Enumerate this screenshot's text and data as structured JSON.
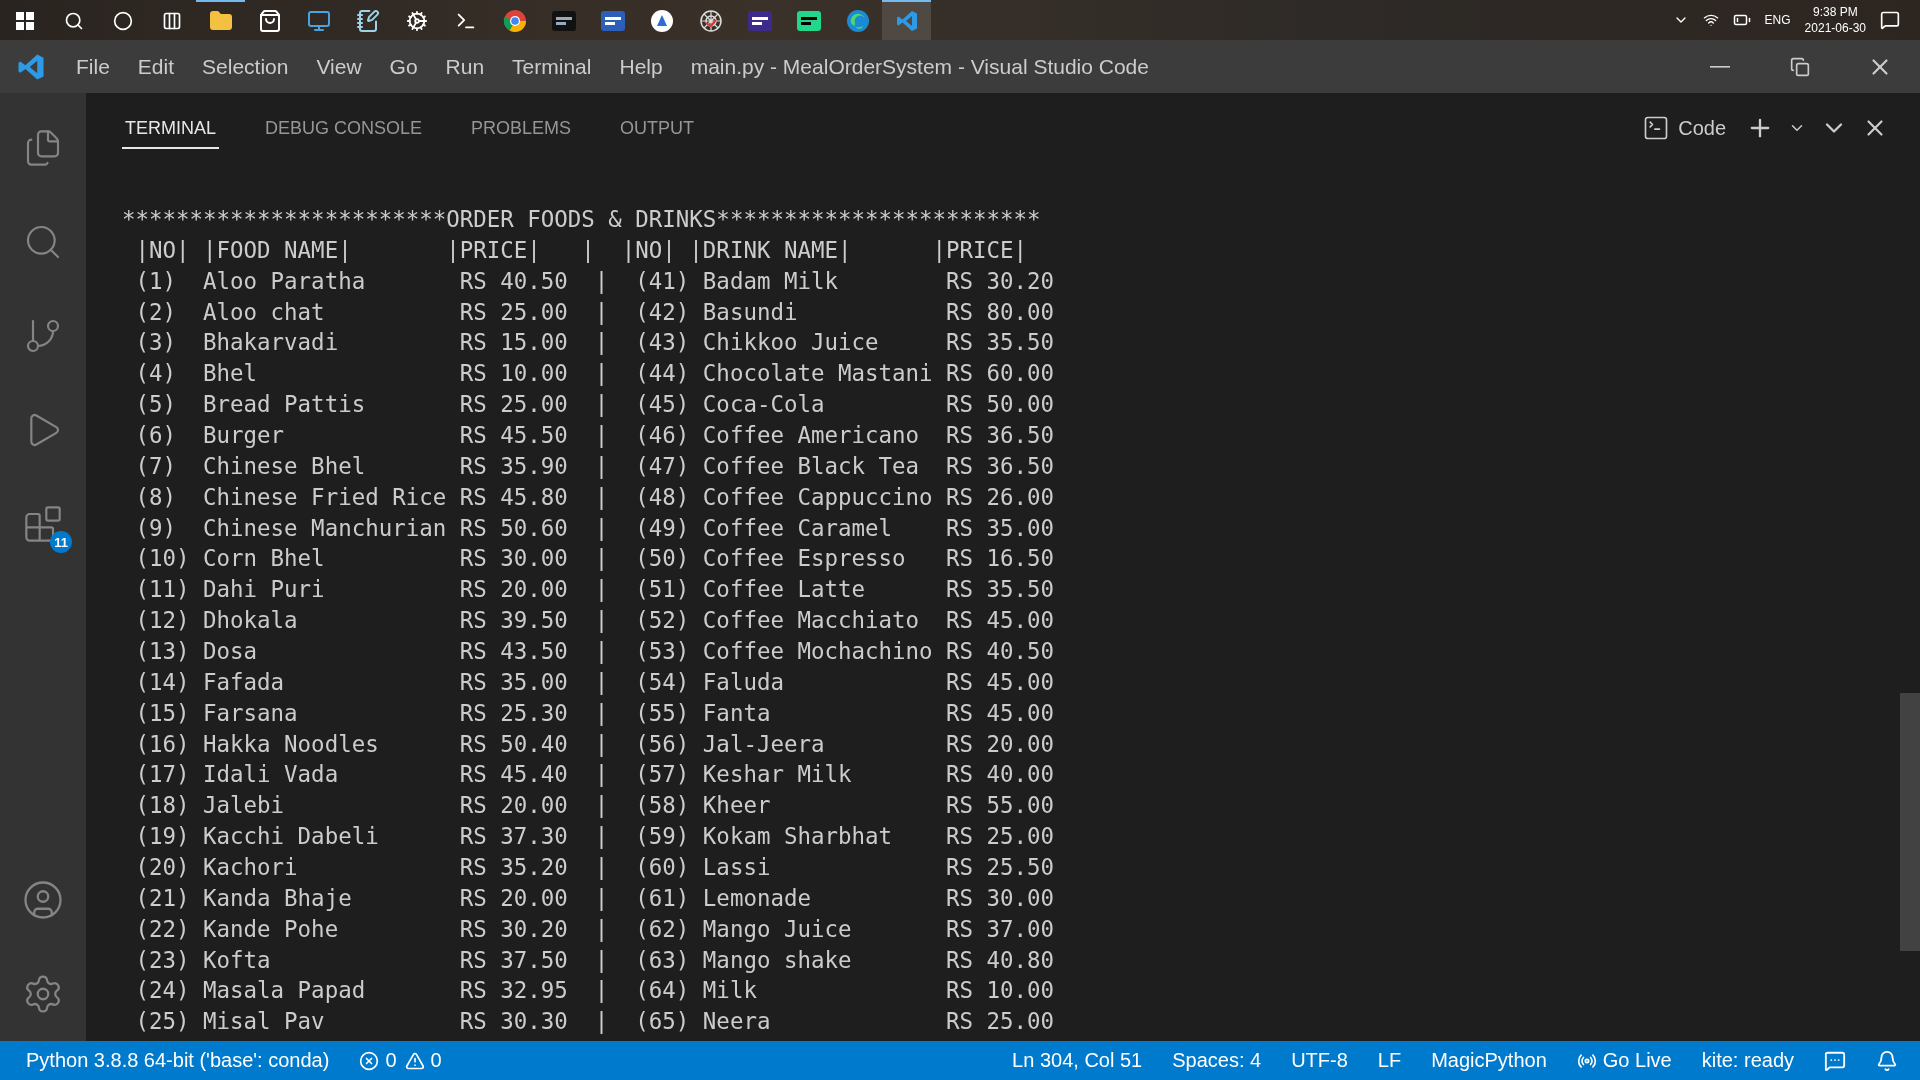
{
  "taskbar": {
    "tray": {
      "language": "ENG",
      "time": "9:38 PM",
      "date": "2021-06-30"
    }
  },
  "window": {
    "menu": [
      "File",
      "Edit",
      "Selection",
      "View",
      "Go",
      "Run",
      "Terminal",
      "Help"
    ],
    "title": "main.py - MealOrderSystem - Visual Studio Code"
  },
  "activity_bar": {
    "extensions_badge": "11"
  },
  "panel": {
    "tabs": [
      {
        "label": "TERMINAL",
        "selected": true
      },
      {
        "label": "DEBUG CONSOLE",
        "selected": false
      },
      {
        "label": "PROBLEMS",
        "selected": false
      },
      {
        "label": "OUTPUT",
        "selected": false
      }
    ],
    "terminal_name": "Code"
  },
  "terminal": {
    "banner": "************************ORDER FOODS & DRINKS************************",
    "separator": "|",
    "headers": [
      "|NO|",
      "|FOOD NAME|",
      "|PRICE|",
      "|NO|",
      "|DRINK NAME|",
      "|PRICE|"
    ],
    "rows": [
      {
        "food_no": "(1)",
        "food": "Aloo Paratha",
        "food_price": "RS 40.50",
        "drink_no": "(41)",
        "drink": "Badam Milk",
        "drink_price": "RS 30.20"
      },
      {
        "food_no": "(2)",
        "food": "Aloo chat",
        "food_price": "RS 25.00",
        "drink_no": "(42)",
        "drink": "Basundi",
        "drink_price": "RS 80.00"
      },
      {
        "food_no": "(3)",
        "food": "Bhakarvadi",
        "food_price": "RS 15.00",
        "drink_no": "(43)",
        "drink": "Chikkoo Juice",
        "drink_price": "RS 35.50"
      },
      {
        "food_no": "(4)",
        "food": "Bhel",
        "food_price": "RS 10.00",
        "drink_no": "(44)",
        "drink": "Chocolate Mastani",
        "drink_price": "RS 60.00"
      },
      {
        "food_no": "(5)",
        "food": "Bread Pattis",
        "food_price": "RS 25.00",
        "drink_no": "(45)",
        "drink": "Coca-Cola",
        "drink_price": "RS 50.00"
      },
      {
        "food_no": "(6)",
        "food": "Burger",
        "food_price": "RS 45.50",
        "drink_no": "(46)",
        "drink": "Coffee Americano",
        "drink_price": "RS 36.50"
      },
      {
        "food_no": "(7)",
        "food": "Chinese Bhel",
        "food_price": "RS 35.90",
        "drink_no": "(47)",
        "drink": "Coffee Black Tea",
        "drink_price": "RS 36.50"
      },
      {
        "food_no": "(8)",
        "food": "Chinese Fried Rice",
        "food_price": "RS 45.80",
        "drink_no": "(48)",
        "drink": "Coffee Cappuccino",
        "drink_price": "RS 26.00"
      },
      {
        "food_no": "(9)",
        "food": "Chinese Manchurian",
        "food_price": "RS 50.60",
        "drink_no": "(49)",
        "drink": "Coffee Caramel",
        "drink_price": "RS 35.00"
      },
      {
        "food_no": "(10)",
        "food": "Corn Bhel",
        "food_price": "RS 30.00",
        "drink_no": "(50)",
        "drink": "Coffee Espresso",
        "drink_price": "RS 16.50"
      },
      {
        "food_no": "(11)",
        "food": "Dahi Puri",
        "food_price": "RS 20.00",
        "drink_no": "(51)",
        "drink": "Coffee Latte",
        "drink_price": "RS 35.50"
      },
      {
        "food_no": "(12)",
        "food": "Dhokala",
        "food_price": "RS 39.50",
        "drink_no": "(52)",
        "drink": "Coffee Macchiato",
        "drink_price": "RS 45.00"
      },
      {
        "food_no": "(13)",
        "food": "Dosa",
        "food_price": "RS 43.50",
        "drink_no": "(53)",
        "drink": "Coffee Mochachino",
        "drink_price": "RS 40.50"
      },
      {
        "food_no": "(14)",
        "food": "Fafada",
        "food_price": "RS 35.00",
        "drink_no": "(54)",
        "drink": "Faluda",
        "drink_price": "RS 45.00"
      },
      {
        "food_no": "(15)",
        "food": "Farsana",
        "food_price": "RS 25.30",
        "drink_no": "(55)",
        "drink": "Fanta",
        "drink_price": "RS 45.00"
      },
      {
        "food_no": "(16)",
        "food": "Hakka Noodles",
        "food_price": "RS 50.40",
        "drink_no": "(56)",
        "drink": "Jal-Jeera",
        "drink_price": "RS 20.00"
      },
      {
        "food_no": "(17)",
        "food": "Idali Vada",
        "food_price": "RS 45.40",
        "drink_no": "(57)",
        "drink": "Keshar Milk",
        "drink_price": "RS 40.00"
      },
      {
        "food_no": "(18)",
        "food": "Jalebi",
        "food_price": "RS 20.00",
        "drink_no": "(58)",
        "drink": "Kheer",
        "drink_price": "RS 55.00"
      },
      {
        "food_no": "(19)",
        "food": "Kacchi Dabeli",
        "food_price": "RS 37.30",
        "drink_no": "(59)",
        "drink": "Kokam Sharbhat",
        "drink_price": "RS 25.00"
      },
      {
        "food_no": "(20)",
        "food": "Kachori",
        "food_price": "RS 35.20",
        "drink_no": "(60)",
        "drink": "Lassi",
        "drink_price": "RS 25.50"
      },
      {
        "food_no": "(21)",
        "food": "Kanda Bhaje",
        "food_price": "RS 20.00",
        "drink_no": "(61)",
        "drink": "Lemonade",
        "drink_price": "RS 30.00"
      },
      {
        "food_no": "(22)",
        "food": "Kande Pohe",
        "food_price": "RS 30.20",
        "drink_no": "(62)",
        "drink": "Mango Juice",
        "drink_price": "RS 37.00"
      },
      {
        "food_no": "(23)",
        "food": "Kofta",
        "food_price": "RS 37.50",
        "drink_no": "(63)",
        "drink": "Mango shake",
        "drink_price": "RS 40.80"
      },
      {
        "food_no": "(24)",
        "food": "Masala Papad",
        "food_price": "RS 32.95",
        "drink_no": "(64)",
        "drink": "Milk",
        "drink_price": "RS 10.00"
      },
      {
        "food_no": "(25)",
        "food": "Misal Pav",
        "food_price": "RS 30.30",
        "drink_no": "(65)",
        "drink": "Neera",
        "drink_price": "RS 25.00"
      }
    ]
  },
  "status_bar": {
    "interpreter": "Python 3.8.8 64-bit ('base': conda)",
    "errors": "0",
    "warnings": "0",
    "position": "Ln 304, Col 51",
    "indentation": "Spaces: 4",
    "encoding": "UTF-8",
    "eol": "LF",
    "language": "MagicPython",
    "go_live": "Go Live",
    "kite": "kite: ready"
  }
}
